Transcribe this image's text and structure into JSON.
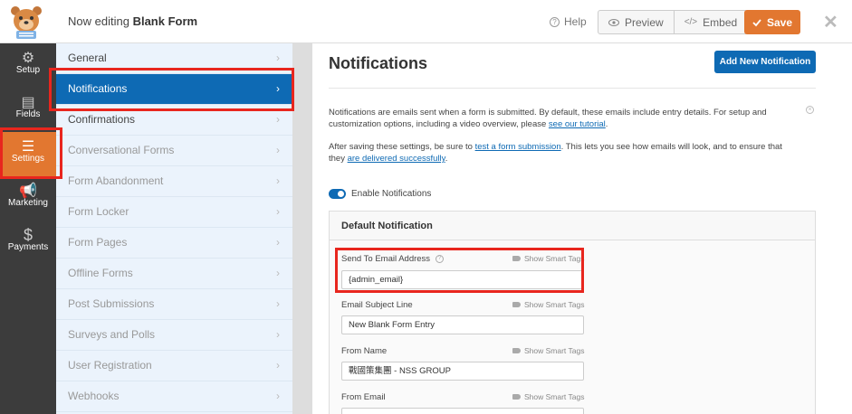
{
  "header": {
    "title_prefix": "Now editing",
    "title_form": "Blank Form",
    "help_label": "Help",
    "preview_label": "Preview",
    "embed_label": "Embed",
    "save_label": "Save"
  },
  "iconbar": {
    "items": [
      {
        "label": "Setup",
        "icon": "gear-icon"
      },
      {
        "label": "Fields",
        "icon": "fields-icon"
      },
      {
        "label": "Settings",
        "icon": "sliders-icon"
      },
      {
        "label": "Marketing",
        "icon": "megaphone-icon"
      },
      {
        "label": "Payments",
        "icon": "dollar-icon"
      }
    ]
  },
  "submenu": {
    "items": [
      {
        "label": "General"
      },
      {
        "label": "Notifications"
      },
      {
        "label": "Confirmations"
      },
      {
        "label": "Conversational Forms"
      },
      {
        "label": "Form Abandonment"
      },
      {
        "label": "Form Locker"
      },
      {
        "label": "Form Pages"
      },
      {
        "label": "Offline Forms"
      },
      {
        "label": "Post Submissions"
      },
      {
        "label": "Surveys and Polls"
      },
      {
        "label": "User Registration"
      },
      {
        "label": "Webhooks"
      }
    ]
  },
  "main": {
    "title": "Notifications",
    "add_button": "Add New Notification",
    "intro": {
      "text1": "Notifications are emails sent when a form is submitted. By default, these emails include entry details. For setup and customization options, including a video overview, please ",
      "link1": "see our tutorial",
      "end1": "."
    },
    "after": {
      "text1": "After saving these settings, be sure to ",
      "link1": "test a form submission",
      "text2": ". This lets you see how emails will look, and to ensure that they ",
      "link2": "are delivered successfully",
      "end": "."
    },
    "toggle_label": "Enable Notifications",
    "panel": {
      "title": "Default Notification",
      "smart_tags": "Show Smart Tags",
      "fields": [
        {
          "label": "Send To Email Address",
          "value": "{admin_email}"
        },
        {
          "label": "Email Subject Line",
          "value": "New Blank Form Entry"
        },
        {
          "label": "From Name",
          "value": "戰國策集團 - NSS GROUP"
        },
        {
          "label": "From Email",
          "value": ""
        }
      ]
    }
  },
  "colors": {
    "accent_orange": "#e27730",
    "primary_blue": "#0e6ab4",
    "highlight_red": "#e8261e"
  }
}
